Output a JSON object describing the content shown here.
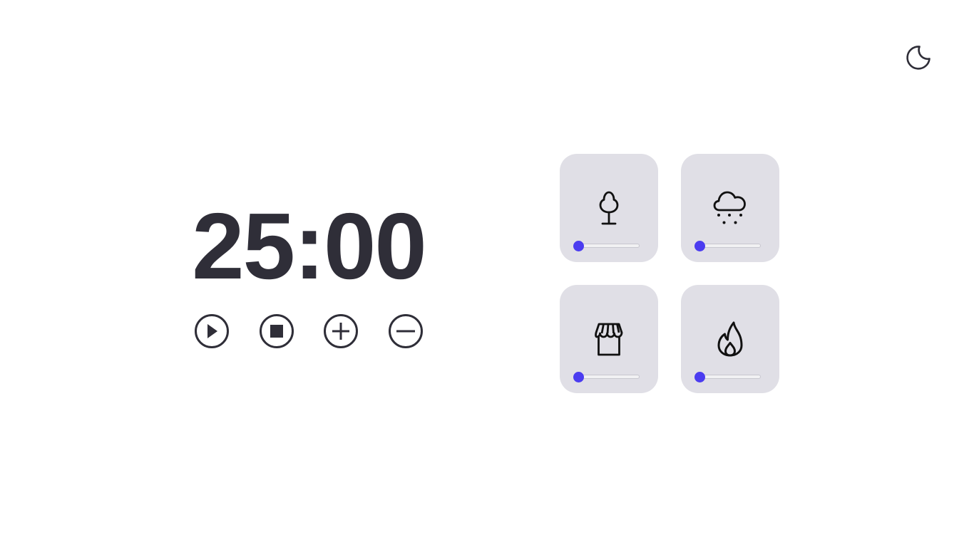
{
  "timer": {
    "display": "25:00"
  },
  "controls": [
    {
      "name": "play-button",
      "icon": "play-icon"
    },
    {
      "name": "stop-button",
      "icon": "stop-icon"
    },
    {
      "name": "increase-button",
      "icon": "plus-icon"
    },
    {
      "name": "decrease-button",
      "icon": "minus-icon"
    }
  ],
  "theme_toggle": {
    "icon": "moon-icon"
  },
  "sounds": [
    {
      "name": "forest",
      "icon": "tree-icon",
      "volume": 0
    },
    {
      "name": "rain",
      "icon": "rain-cloud-icon",
      "volume": 0
    },
    {
      "name": "coffee-shop",
      "icon": "storefront-icon",
      "volume": 0
    },
    {
      "name": "fireplace",
      "icon": "flame-icon",
      "volume": 0
    }
  ],
  "colors": {
    "text": "#2f2e38",
    "card_background": "#e0dfe6",
    "slider_accent": "#4b3cf0"
  }
}
